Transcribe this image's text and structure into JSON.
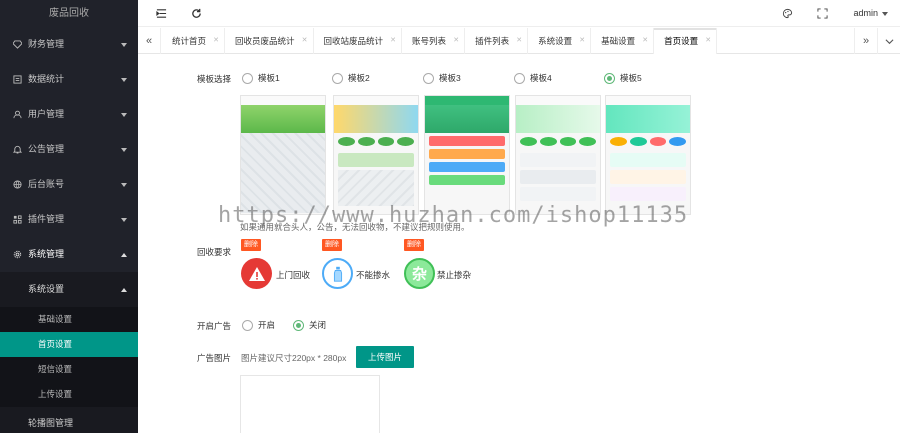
{
  "sidebar": {
    "logo": "废品回收",
    "menu": [
      {
        "label": "财务管理",
        "icon": "diamond-icon"
      },
      {
        "label": "数据统计",
        "icon": "list-icon"
      },
      {
        "label": "用户管理",
        "icon": "user-icon"
      },
      {
        "label": "公告管理",
        "icon": "bell-icon"
      },
      {
        "label": "后台账号",
        "icon": "globe-icon"
      },
      {
        "label": "插件管理",
        "icon": "grid-icon"
      },
      {
        "label": "系统管理",
        "icon": "gear-icon"
      }
    ],
    "submenu_label": "系统设置",
    "subsub": [
      "基础设置",
      "首页设置",
      "短信设置",
      "上传设置"
    ],
    "bottom_item": "轮播图管理"
  },
  "header": {
    "user": "admin"
  },
  "tabs": [
    {
      "label": "统计首页"
    },
    {
      "label": "回收员废品统计"
    },
    {
      "label": "回收站废品统计"
    },
    {
      "label": "账号列表"
    },
    {
      "label": "插件列表"
    },
    {
      "label": "系统设置"
    },
    {
      "label": "基础设置"
    },
    {
      "label": "首页设置"
    }
  ],
  "form": {
    "template_label": "模板选择",
    "templates": [
      "模板1",
      "模板2",
      "模板3",
      "模板4",
      "模板5"
    ],
    "selected_template": "模板5",
    "watermark": "https://www.huzhan.com/ishop11135",
    "hint": "如果通用就合头人，公告，无法回收物，不建议把规则使用。",
    "recycle_label": "回收要求",
    "delete_label": "删除",
    "requirements": [
      {
        "label": "上门回收",
        "icon": "warning-icon"
      },
      {
        "label": "不能掺水",
        "icon": "bottle-icon"
      },
      {
        "label": "禁止掺杂",
        "icon": "mixed-icon"
      }
    ],
    "mixed_char": "杂",
    "ad_label": "开启广告",
    "ad_on": "开启",
    "ad_off": "关闭",
    "ad_image_label": "广告图片",
    "ad_image_hint": "图片建议尺寸220px * 280px",
    "upload_button": "上传图片"
  },
  "colors": {
    "primary": "#009688",
    "sidebar_bg": "#20222a",
    "danger": "#ff5722",
    "radio_checked": "#5fb878"
  }
}
